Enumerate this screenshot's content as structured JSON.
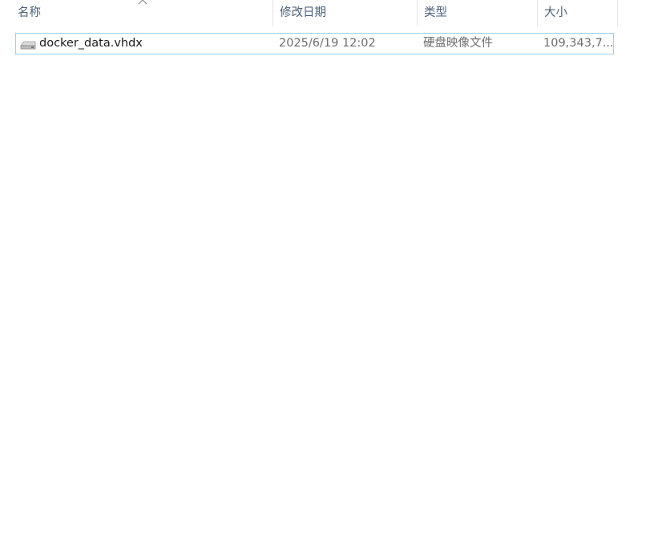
{
  "columns": {
    "name": "名称",
    "date": "修改日期",
    "type": "类型",
    "size": "大小"
  },
  "sort": {
    "column": "name",
    "icon": "chevron-up-icon"
  },
  "files": [
    {
      "icon": "disk-image-icon",
      "name": "docker_data.vhdx",
      "date": "2025/6/19 12:02",
      "type": "硬盘映像文件",
      "size": "109,343,7..."
    }
  ],
  "colors": {
    "header_text": "#4c607a",
    "selection_border": "#99d1ff",
    "secondary_text": "#6d6d6d"
  }
}
